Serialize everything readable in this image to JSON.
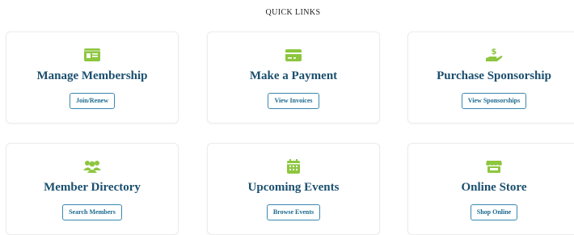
{
  "section": {
    "title": "QUICK LINKS"
  },
  "colors": {
    "icon_green": "#8dc63f",
    "title_blue": "#1b4f6e",
    "button_blue": "#1b6a8f"
  },
  "cards": [
    {
      "title": "Manage Membership",
      "button": "Join/Renew",
      "icon": "id-card-icon"
    },
    {
      "title": "Make a Payment",
      "button": "View Invoices",
      "icon": "credit-card-icon"
    },
    {
      "title": "Purchase Sponsorship",
      "button": "View Sponsorships",
      "icon": "hand-dollar-icon"
    },
    {
      "title": "Member Directory",
      "button": "Search Members",
      "icon": "users-icon"
    },
    {
      "title": "Upcoming Events",
      "button": "Browse Events",
      "icon": "calendar-icon"
    },
    {
      "title": "Online Store",
      "button": "Shop Online",
      "icon": "store-icon"
    }
  ]
}
